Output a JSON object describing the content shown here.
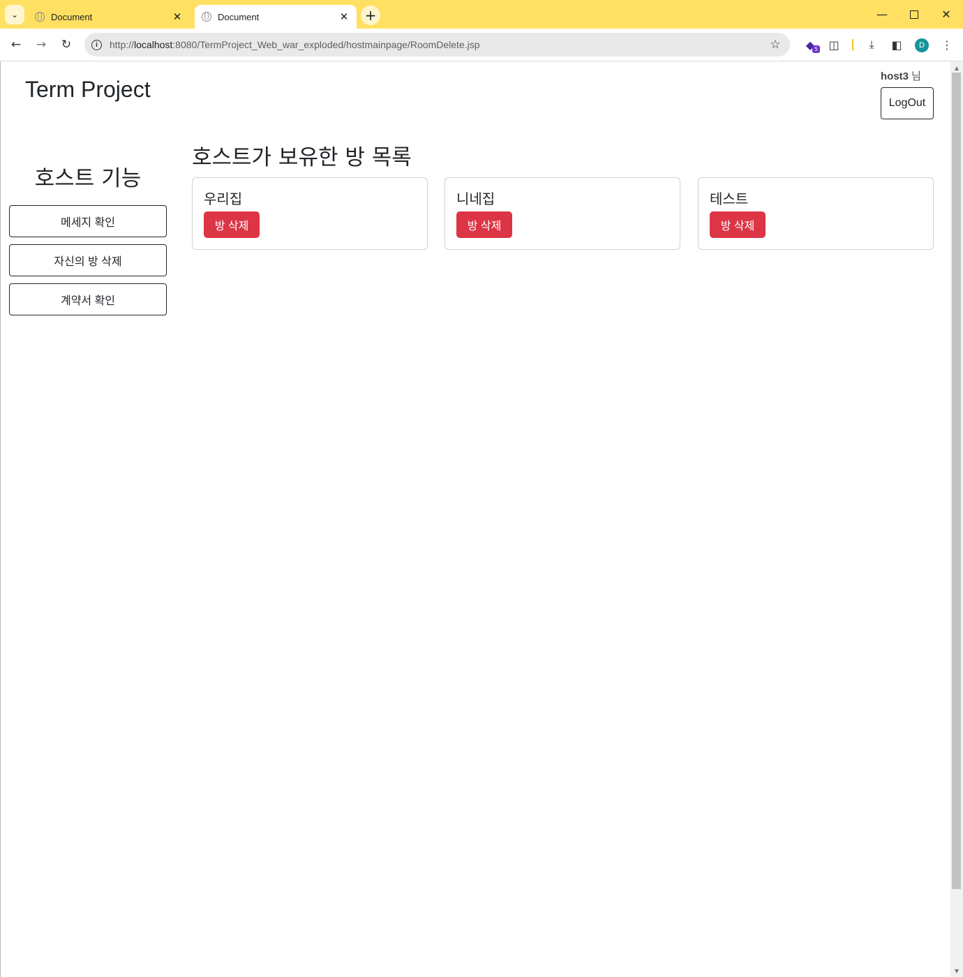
{
  "browser": {
    "tabs": [
      {
        "title": "Document",
        "active": false
      },
      {
        "title": "Document",
        "active": true
      }
    ],
    "url_prefix": "http://",
    "url_host": "localhost",
    "url_rest": ":8080/TermProject_Web_war_exploded/hostmainpage/RoomDelete.jsp",
    "profile_initial": "D",
    "extension_badge": "5",
    "theme_color": "#ffe062"
  },
  "header": {
    "brand": "Term Project",
    "username": "host3",
    "user_suffix": " 님",
    "logout_label": "LogOut"
  },
  "sidebar": {
    "title": "호스트 기능",
    "items": [
      {
        "label": "메세지 확인"
      },
      {
        "label": "자신의 방 삭제"
      },
      {
        "label": "계약서 확인"
      }
    ]
  },
  "main": {
    "title": "호스트가 보유한 방 목록",
    "rooms": [
      {
        "name": "우리집",
        "action_label": "방 삭제"
      },
      {
        "name": "니네집",
        "action_label": "방 삭제"
      },
      {
        "name": "테스트",
        "action_label": "방 삭제"
      }
    ],
    "danger_color": "#dc3545"
  }
}
